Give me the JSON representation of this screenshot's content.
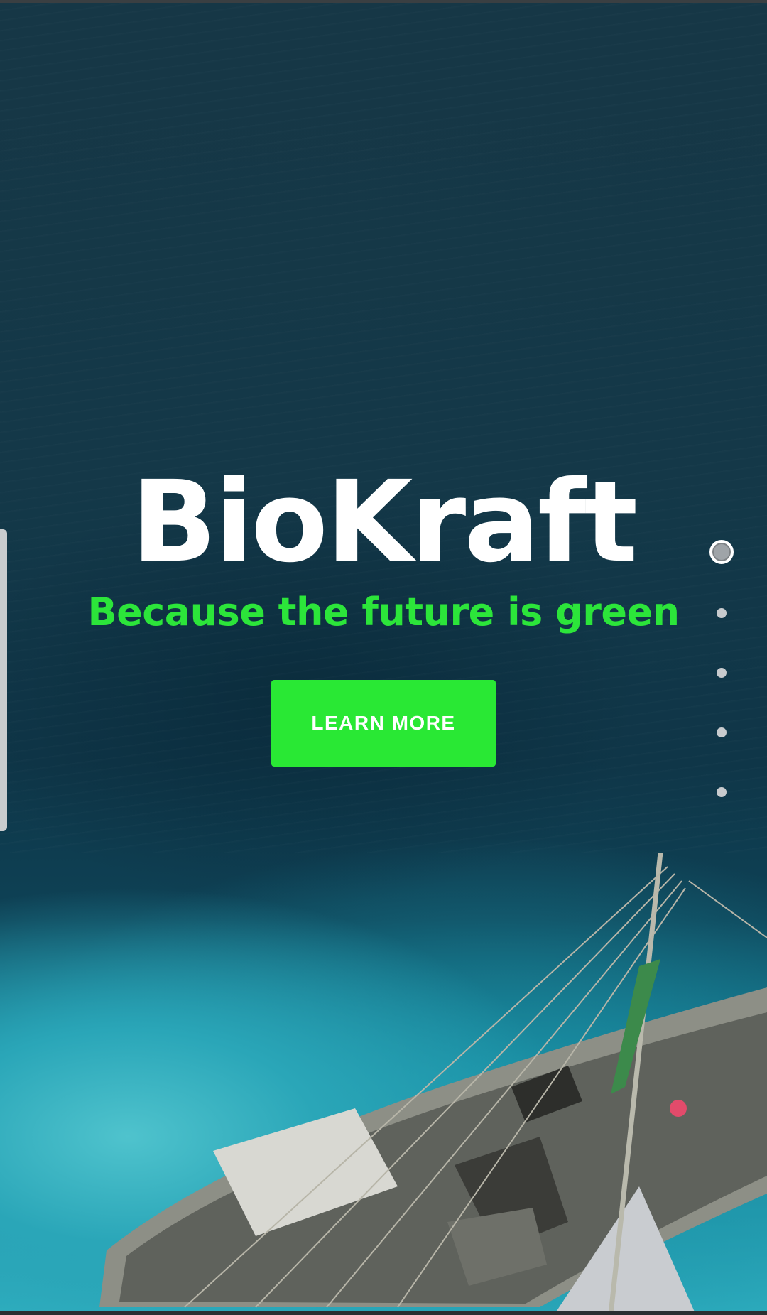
{
  "hero": {
    "title": "BioKraft",
    "tagline": "Because the future is green",
    "cta_label": "LEARN MORE"
  },
  "pager": {
    "total": 5,
    "active_index": 0
  },
  "colors": {
    "accent_green": "#29e834",
    "tagline_green": "#2ce53a",
    "title_white": "#ffffff"
  },
  "icons": {
    "background_image": "aerial-boat-on-water-photo"
  }
}
